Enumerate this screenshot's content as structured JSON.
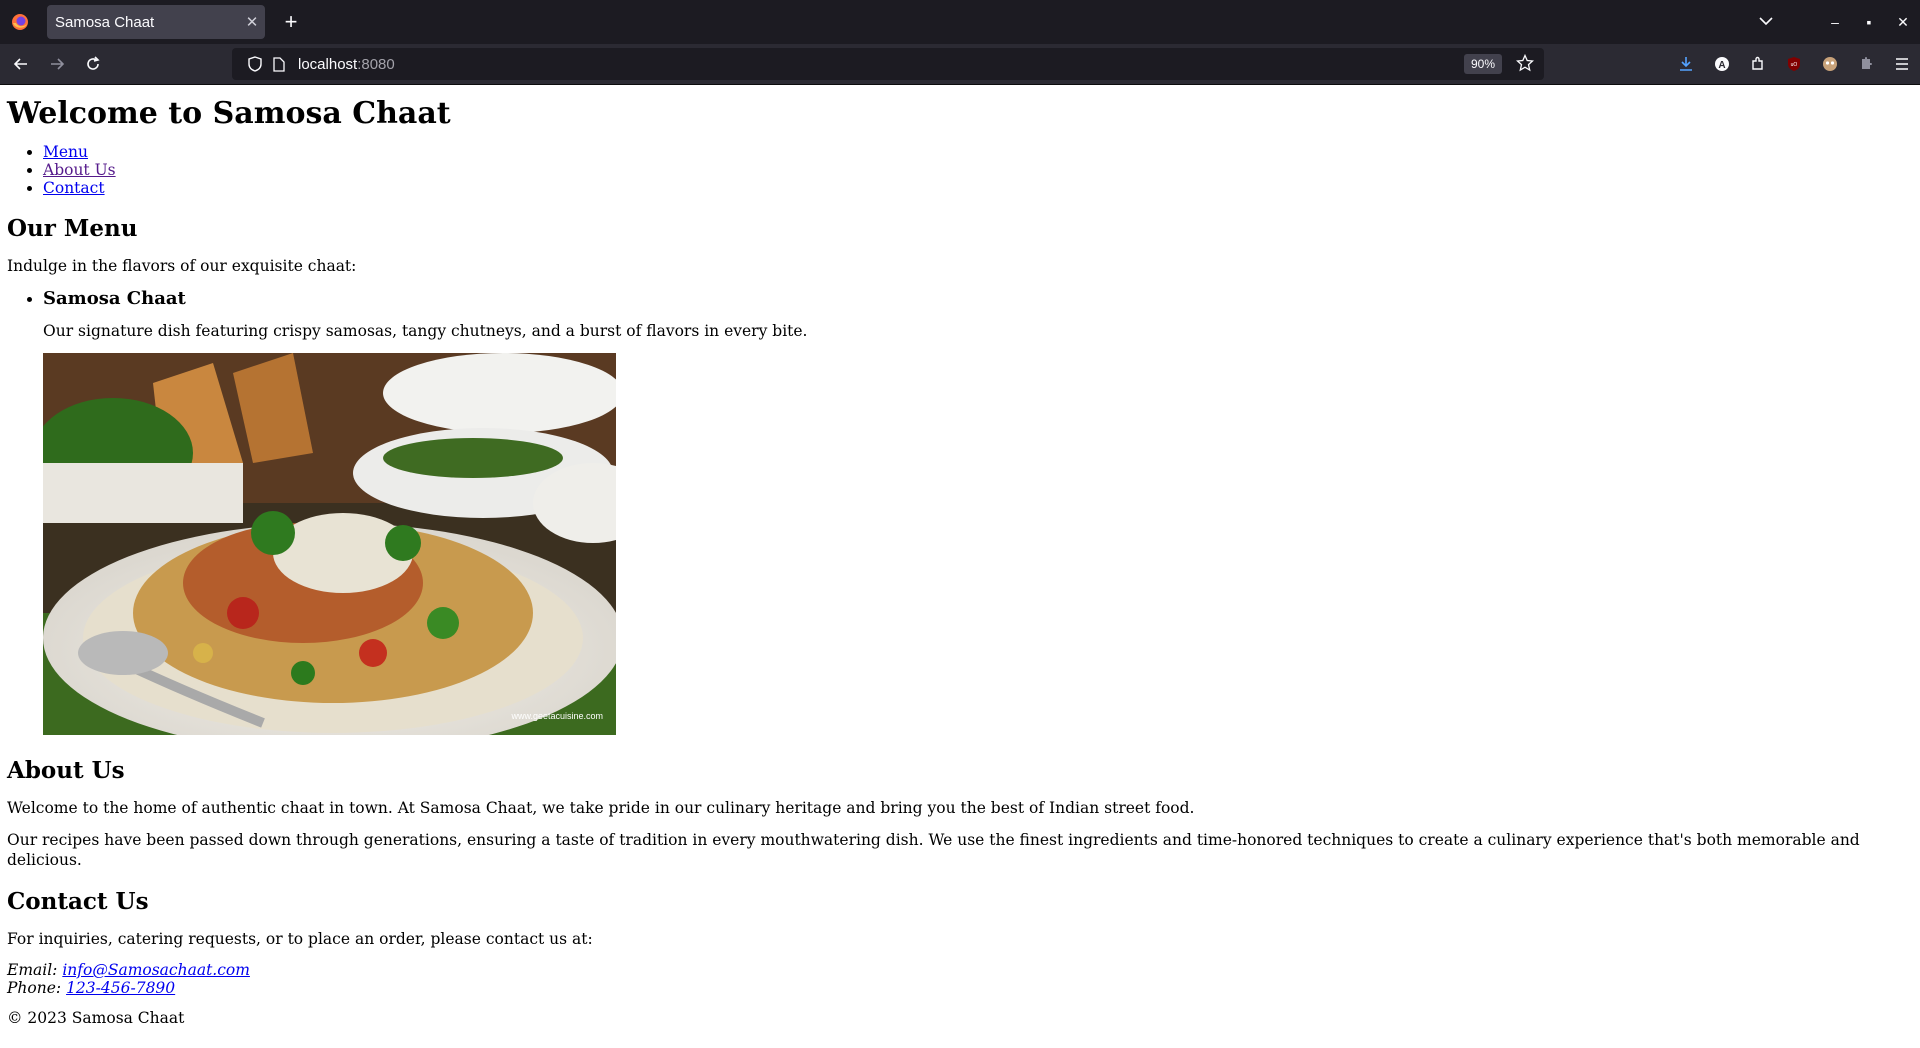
{
  "browser": {
    "tab_title": "Samosa Chaat",
    "url_host": "localhost",
    "url_port": ":8080",
    "zoom": "90%",
    "accent": "#1c1b22"
  },
  "page": {
    "heading": "Welcome to Samosa Chaat",
    "nav": [
      "Menu",
      "About Us",
      "Contact"
    ],
    "menu": {
      "heading": "Our Menu",
      "intro": "Indulge in the flavors of our exquisite chaat:",
      "item_title": "Samosa Chaat",
      "item_desc": "Our signature dish featuring crispy samosas, tangy chutneys, and a burst of flavors in every bite.",
      "image_watermark": "www.geetacuisine.com"
    },
    "about": {
      "heading": "About Us",
      "p1": "Welcome to the home of authentic chaat in town. At Samosa Chaat, we take pride in our culinary heritage and bring you the best of Indian street food.",
      "p2": "Our recipes have been passed down through generations, ensuring a taste of tradition in every mouthwatering dish. We use the finest ingredients and time-honored techniques to create a culinary experience that's both memorable and delicious."
    },
    "contact": {
      "heading": "Contact Us",
      "intro": "For inquiries, catering requests, or to place an order, please contact us at:",
      "email_label": "Email:",
      "email": "info@Samosachaat.com",
      "phone_label": "Phone:",
      "phone": "123-456-7890"
    },
    "footer": "© 2023 Samosa Chaat"
  }
}
